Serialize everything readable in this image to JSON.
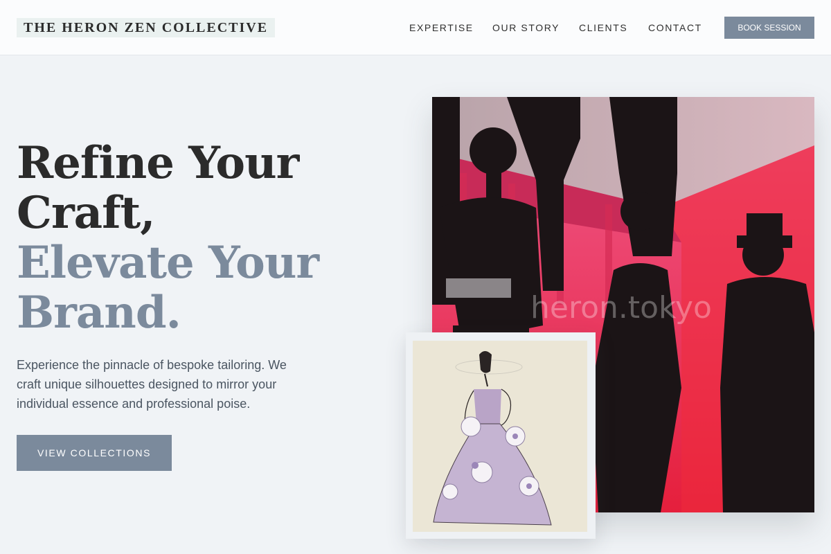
{
  "header": {
    "logo": "THE HERON ZEN COLLECTIVE",
    "nav": [
      "EXPERTISE",
      "OUR STORY",
      "CLIENTS",
      "CONTACT"
    ],
    "cta": "BOOK SESSION"
  },
  "hero": {
    "title_lines": [
      "Refine Your",
      "Craft,",
      "Elevate Your",
      "Brand."
    ],
    "description_lines": [
      "Experience the pinnacle of bespoke tailoring. We",
      "craft unique silhouettes designed to mirror your",
      "individual essence and professional poise."
    ],
    "button": "VIEW COLLECTIONS"
  },
  "images": {
    "main_watermark": "heron.tokyo"
  },
  "colors": {
    "accent": "#7b8a9c",
    "background": "#f0f3f6",
    "header_bg": "#fbfcfd",
    "heading_dark": "#2b2b2b",
    "photo_magenta": "#e0286a"
  }
}
